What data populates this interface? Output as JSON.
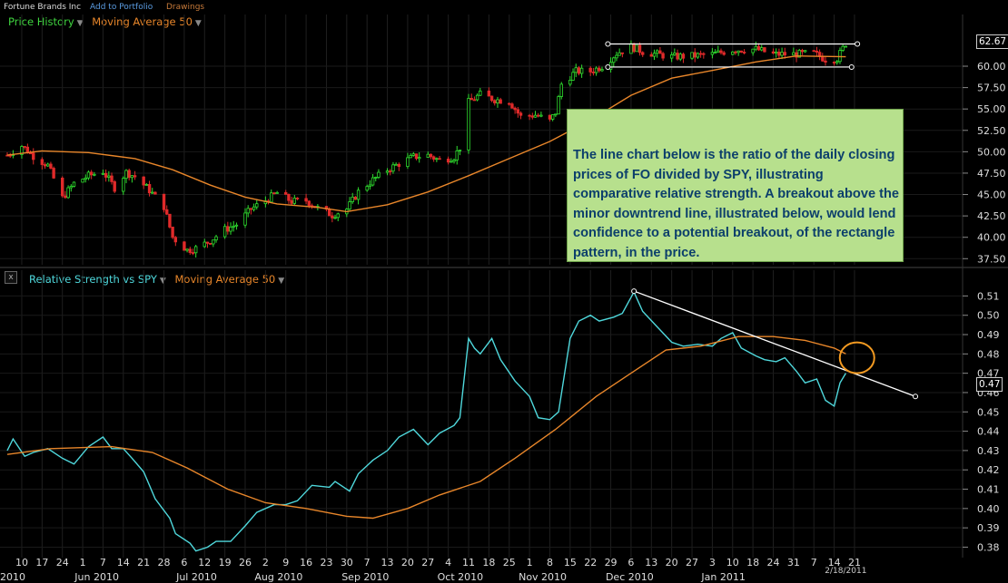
{
  "header": {
    "company": "Fortune Brands Inc",
    "add_portfolio": "Add to Portfolio",
    "drawings": "Drawings"
  },
  "price_panel": {
    "title": "Price History",
    "ma_label": "Moving Average 50",
    "last_value": "62.67",
    "title_color": "#3fd43f",
    "ma_color": "#e8862a"
  },
  "rs_panel": {
    "close": "x",
    "title": "Relative Strength vs SPY",
    "ma_label": "Moving Average 50",
    "last_value": "0.47",
    "title_color": "#4fd8dc",
    "ma_color": "#e8862a"
  },
  "callout": {
    "text": "The line chart below is the ratio of the daily closing prices of FO divided by SPY, illustrating comparative relative strength. A breakout above the minor downtrend line, illustrated below, would lend confidence to a potential breakout, of the rectangle pattern, in the price."
  },
  "x_axis": {
    "day_ticks": [
      "10",
      "17",
      "24",
      "1",
      "7",
      "14",
      "21",
      "28",
      "6",
      "12",
      "19",
      "26",
      "2",
      "9",
      "16",
      "23",
      "30",
      "7",
      "13",
      "20",
      "27",
      "4",
      "11",
      "18",
      "25",
      "1",
      "8",
      "15",
      "22",
      "29",
      "6",
      "13",
      "20",
      "27",
      "3",
      "10",
      "18",
      "24",
      "31",
      "7",
      "14",
      "21"
    ],
    "month_labels": [
      "2010",
      "Jun 2010",
      "Jul 2010",
      "Aug 2010",
      "Sep 2010",
      "Oct 2010",
      "Nov 2010",
      "Dec 2010",
      "Jan 2011"
    ],
    "cursor_date": "2/18/2011"
  },
  "chart_data": [
    {
      "type": "candlestick",
      "title": "Price History",
      "overlay": "Moving Average 50",
      "y_ticks": [
        "60.00",
        "57.50",
        "55.00",
        "52.50",
        "50.00",
        "47.50",
        "45.00",
        "42.50",
        "40.00",
        "37.50"
      ],
      "ylim": [
        37.0,
        63.5
      ],
      "x_range": [
        "2010-05-05",
        "2011-03-24"
      ],
      "close_series": [
        [
          "2010-05-05",
          49.6
        ],
        [
          "2010-05-10",
          50.7
        ],
        [
          "2010-05-14",
          49.5
        ],
        [
          "2010-05-19",
          48.4
        ],
        [
          "2010-05-24",
          44.6
        ],
        [
          "2010-05-28",
          46.3
        ],
        [
          "2010-06-02",
          47.2
        ],
        [
          "2010-06-07",
          47.7
        ],
        [
          "2010-06-11",
          45.8
        ],
        [
          "2010-06-15",
          47.6
        ],
        [
          "2010-06-18",
          47.1
        ],
        [
          "2010-06-23",
          45.5
        ],
        [
          "2010-06-28",
          43.6
        ],
        [
          "2010-07-01",
          40.0
        ],
        [
          "2010-07-06",
          38.5
        ],
        [
          "2010-07-09",
          38.7
        ],
        [
          "2010-07-14",
          39.6
        ],
        [
          "2010-07-19",
          40.9
        ],
        [
          "2010-07-23",
          41.5
        ],
        [
          "2010-07-28",
          43.3
        ],
        [
          "2010-08-02",
          44.3
        ],
        [
          "2010-08-06",
          45.2
        ],
        [
          "2010-08-11",
          44.2
        ],
        [
          "2010-08-16",
          44.3
        ],
        [
          "2010-08-20",
          43.4
        ],
        [
          "2010-08-25",
          42.6
        ],
        [
          "2010-08-30",
          43.3
        ],
        [
          "2010-09-03",
          45.3
        ],
        [
          "2010-09-08",
          46.7
        ],
        [
          "2010-09-13",
          47.9
        ],
        [
          "2010-09-17",
          48.6
        ],
        [
          "2010-09-22",
          49.4
        ],
        [
          "2010-09-27",
          49.6
        ],
        [
          "2010-10-01",
          49.0
        ],
        [
          "2010-10-06",
          49.4
        ],
        [
          "2010-10-08",
          50.5
        ],
        [
          "2010-10-11",
          55.8
        ],
        [
          "2010-10-15",
          56.7
        ],
        [
          "2010-10-20",
          56.1
        ],
        [
          "2010-10-25",
          55.9
        ],
        [
          "2010-10-29",
          54.1
        ],
        [
          "2010-11-03",
          54.3
        ],
        [
          "2010-11-08",
          53.6
        ],
        [
          "2010-11-10",
          54.6
        ],
        [
          "2010-11-12",
          57.9
        ],
        [
          "2010-11-17",
          59.4
        ],
        [
          "2010-11-22",
          59.4
        ],
        [
          "2010-11-26",
          60.0
        ],
        [
          "2010-12-01",
          61.5
        ],
        [
          "2010-12-06",
          62.3
        ],
        [
          "2010-12-10",
          61.7
        ],
        [
          "2010-12-15",
          61.4
        ],
        [
          "2010-12-20",
          61.1
        ],
        [
          "2010-12-27",
          61.2
        ],
        [
          "2011-01-03",
          61.4
        ],
        [
          "2011-01-10",
          61.9
        ],
        [
          "2011-01-18",
          62.0
        ],
        [
          "2011-01-24",
          61.4
        ],
        [
          "2011-01-31",
          61.4
        ],
        [
          "2011-02-07",
          61.5
        ],
        [
          "2011-02-11",
          60.8
        ],
        [
          "2011-02-15",
          60.9
        ],
        [
          "2011-02-18",
          62.67
        ]
      ],
      "ma50": [
        [
          "2010-05-05",
          49.6
        ],
        [
          "2010-05-17",
          50.1
        ],
        [
          "2010-06-02",
          49.9
        ],
        [
          "2010-06-18",
          49.2
        ],
        [
          "2010-07-01",
          47.9
        ],
        [
          "2010-07-14",
          46.1
        ],
        [
          "2010-07-26",
          44.7
        ],
        [
          "2010-08-06",
          43.9
        ],
        [
          "2010-08-20",
          43.5
        ],
        [
          "2010-08-30",
          43.0
        ],
        [
          "2010-09-13",
          43.8
        ],
        [
          "2010-09-27",
          45.3
        ],
        [
          "2010-10-11",
          47.2
        ],
        [
          "2010-10-25",
          49.2
        ],
        [
          "2010-11-08",
          51.2
        ],
        [
          "2010-11-22",
          53.7
        ],
        [
          "2010-12-06",
          56.6
        ],
        [
          "2010-12-20",
          58.6
        ],
        [
          "2011-01-03",
          59.5
        ],
        [
          "2011-01-18",
          60.5
        ],
        [
          "2011-02-01",
          61.2
        ],
        [
          "2011-02-18",
          61.1
        ]
      ],
      "annotations": [
        {
          "kind": "rectangle_top",
          "from": [
            "2010-11-28",
            62.6
          ],
          "to": [
            "2011-02-22",
            62.6
          ]
        },
        {
          "kind": "rectangle_bottom",
          "from": [
            "2010-11-28",
            59.9
          ],
          "to": [
            "2011-02-20",
            59.9
          ]
        }
      ]
    },
    {
      "type": "line",
      "title": "Relative Strength vs SPY",
      "overlay": "Moving Average 50",
      "y_ticks": [
        "0.51",
        "0.50",
        "0.49",
        "0.48",
        "0.47",
        "0.46",
        "0.45",
        "0.44",
        "0.43",
        "0.42",
        "0.41",
        "0.40",
        "0.39",
        "0.38"
      ],
      "ylim": [
        0.376,
        0.513
      ],
      "x_range": [
        "2010-05-05",
        "2011-03-24"
      ],
      "series": [
        {
          "name": "Relative Strength vs SPY",
          "values": [
            [
              "2010-05-05",
              0.43
            ],
            [
              "2010-05-07",
              0.436
            ],
            [
              "2010-05-11",
              0.427
            ],
            [
              "2010-05-14",
              0.429
            ],
            [
              "2010-05-19",
              0.431
            ],
            [
              "2010-05-24",
              0.426
            ],
            [
              "2010-05-28",
              0.423
            ],
            [
              "2010-06-02",
              0.432
            ],
            [
              "2010-06-07",
              0.437
            ],
            [
              "2010-06-10",
              0.431
            ],
            [
              "2010-06-14",
              0.431
            ],
            [
              "2010-06-17",
              0.426
            ],
            [
              "2010-06-21",
              0.419
            ],
            [
              "2010-06-25",
              0.405
            ],
            [
              "2010-06-30",
              0.395
            ],
            [
              "2010-07-02",
              0.387
            ],
            [
              "2010-07-07",
              0.382
            ],
            [
              "2010-07-09",
              0.378
            ],
            [
              "2010-07-13",
              0.38
            ],
            [
              "2010-07-16",
              0.383
            ],
            [
              "2010-07-21",
              0.383
            ],
            [
              "2010-07-26",
              0.391
            ],
            [
              "2010-07-30",
              0.398
            ],
            [
              "2010-08-05",
              0.402
            ],
            [
              "2010-08-09",
              0.402
            ],
            [
              "2010-08-13",
              0.404
            ],
            [
              "2010-08-18",
              0.412
            ],
            [
              "2010-08-24",
              0.411
            ],
            [
              "2010-08-26",
              0.414
            ],
            [
              "2010-08-31",
              0.409
            ],
            [
              "2010-09-03",
              0.418
            ],
            [
              "2010-09-08",
              0.425
            ],
            [
              "2010-09-13",
              0.43
            ],
            [
              "2010-09-17",
              0.437
            ],
            [
              "2010-09-22",
              0.441
            ],
            [
              "2010-09-27",
              0.433
            ],
            [
              "2010-10-01",
              0.439
            ],
            [
              "2010-10-06",
              0.443
            ],
            [
              "2010-10-08",
              0.447
            ],
            [
              "2010-10-11",
              0.488
            ],
            [
              "2010-10-13",
              0.483
            ],
            [
              "2010-10-15",
              0.48
            ],
            [
              "2010-10-19",
              0.488
            ],
            [
              "2010-10-22",
              0.477
            ],
            [
              "2010-10-27",
              0.466
            ],
            [
              "2010-11-01",
              0.458
            ],
            [
              "2010-11-04",
              0.447
            ],
            [
              "2010-11-08",
              0.446
            ],
            [
              "2010-11-11",
              0.45
            ],
            [
              "2010-11-15",
              0.488
            ],
            [
              "2010-11-18",
              0.497
            ],
            [
              "2010-11-22",
              0.5
            ],
            [
              "2010-11-25",
              0.497
            ],
            [
              "2010-11-30",
              0.499
            ],
            [
              "2010-12-03",
              0.501
            ],
            [
              "2010-12-07",
              0.512
            ],
            [
              "2010-12-10",
              0.502
            ],
            [
              "2010-12-15",
              0.494
            ],
            [
              "2010-12-20",
              0.486
            ],
            [
              "2010-12-24",
              0.484
            ],
            [
              "2010-12-29",
              0.485
            ],
            [
              "2011-01-03",
              0.484
            ],
            [
              "2011-01-06",
              0.488
            ],
            [
              "2011-01-10",
              0.491
            ],
            [
              "2011-01-13",
              0.483
            ],
            [
              "2011-01-18",
              0.479
            ],
            [
              "2011-01-21",
              0.477
            ],
            [
              "2011-01-25",
              0.476
            ],
            [
              "2011-01-28",
              0.478
            ],
            [
              "2011-02-01",
              0.471
            ],
            [
              "2011-02-04",
              0.465
            ],
            [
              "2011-02-08",
              0.467
            ],
            [
              "2011-02-11",
              0.456
            ],
            [
              "2011-02-14",
              0.453
            ],
            [
              "2011-02-16",
              0.465
            ],
            [
              "2011-02-18",
              0.47
            ]
          ]
        },
        {
          "name": "Moving Average 50",
          "values": [
            [
              "2010-05-05",
              0.428
            ],
            [
              "2010-05-20",
              0.431
            ],
            [
              "2010-06-10",
              0.432
            ],
            [
              "2010-06-24",
              0.429
            ],
            [
              "2010-07-06",
              0.421
            ],
            [
              "2010-07-20",
              0.41
            ],
            [
              "2010-08-02",
              0.403
            ],
            [
              "2010-08-16",
              0.4
            ],
            [
              "2010-08-30",
              0.396
            ],
            [
              "2010-09-08",
              0.395
            ],
            [
              "2010-09-20",
              0.4
            ],
            [
              "2010-10-01",
              0.407
            ],
            [
              "2010-10-15",
              0.414
            ],
            [
              "2010-10-27",
              0.426
            ],
            [
              "2010-11-10",
              0.441
            ],
            [
              "2010-11-24",
              0.458
            ],
            [
              "2010-12-06",
              0.47
            ],
            [
              "2010-12-18",
              0.482
            ],
            [
              "2010-12-30",
              0.484
            ],
            [
              "2011-01-12",
              0.489
            ],
            [
              "2011-01-24",
              0.489
            ],
            [
              "2011-02-04",
              0.487
            ],
            [
              "2011-02-14",
              0.483
            ],
            [
              "2011-02-18",
              0.48
            ]
          ]
        }
      ],
      "annotations": [
        {
          "kind": "trendline",
          "from": [
            "2010-12-07",
            0.5125
          ],
          "to": [
            "2011-03-14",
            0.458
          ]
        },
        {
          "kind": "circle",
          "center": [
            "2011-02-20",
            0.478
          ]
        }
      ]
    }
  ]
}
